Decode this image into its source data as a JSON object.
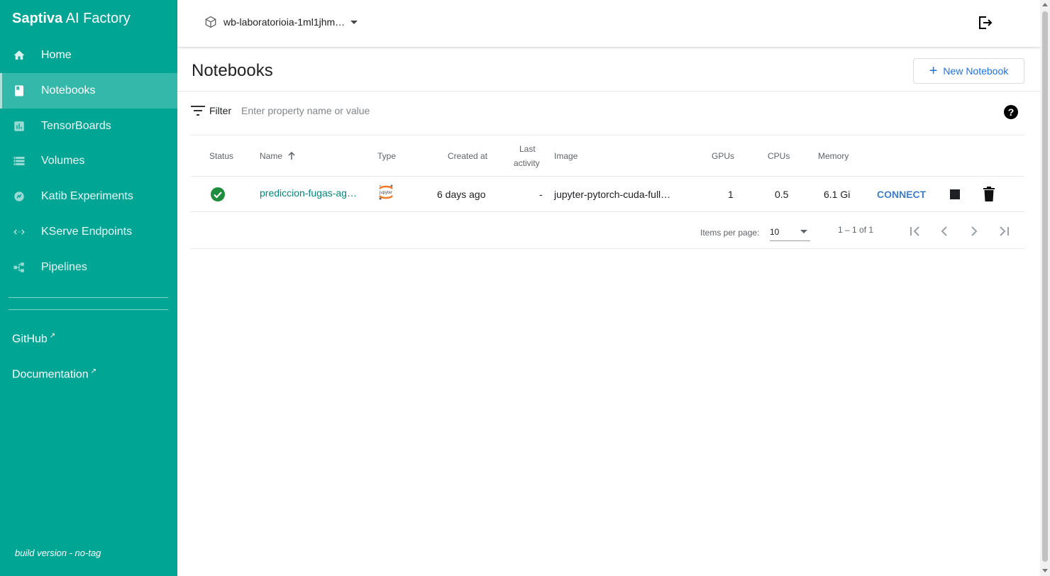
{
  "brand": {
    "bold": "Saptiva",
    "rest": " AI Factory"
  },
  "sidebar": {
    "items": [
      {
        "label": "Home",
        "icon": "home-icon"
      },
      {
        "label": "Notebooks",
        "icon": "notebook-icon",
        "active": true
      },
      {
        "label": "TensorBoards",
        "icon": "chart-icon"
      },
      {
        "label": "Volumes",
        "icon": "storage-icon"
      },
      {
        "label": "Katib Experiments",
        "icon": "katib-icon"
      },
      {
        "label": "KServe Endpoints",
        "icon": "code-arrows-icon"
      },
      {
        "label": "Pipelines",
        "icon": "pipelines-icon"
      }
    ],
    "links": [
      {
        "label": "GitHub"
      },
      {
        "label": "Documentation"
      }
    ],
    "build": "build version - no-tag"
  },
  "topbar": {
    "namespace": "wb-laboratorioia-1ml1jhm…"
  },
  "page": {
    "title": "Notebooks",
    "new_button": "New Notebook"
  },
  "filter": {
    "label": "Filter",
    "placeholder": "Enter property name or value",
    "help": "?"
  },
  "table": {
    "headers": {
      "status": "Status",
      "name": "Name",
      "type": "Type",
      "created": "Created at",
      "last_activity_1": "Last",
      "last_activity_2": "activity",
      "image": "Image",
      "gpus": "GPUs",
      "cpus": "CPUs",
      "memory": "Memory"
    },
    "rows": [
      {
        "status": "ready",
        "name": "prediccion-fugas-ag…",
        "type": "jupyter",
        "created": "6 days ago",
        "last_activity": "-",
        "image": "jupyter-pytorch-cuda-full…",
        "gpus": "1",
        "cpus": "0.5",
        "memory": "6.1 Gi",
        "connect": "CONNECT"
      }
    ]
  },
  "paginator": {
    "items_label": "Items per page:",
    "page_size": "10",
    "range": "1 – 1 of 1"
  },
  "colors": {
    "sidebar": "#00a693",
    "active": "#33b8a9",
    "link": "#00897b",
    "accent": "#3f7ec5",
    "ok": "#1e8e3e"
  }
}
